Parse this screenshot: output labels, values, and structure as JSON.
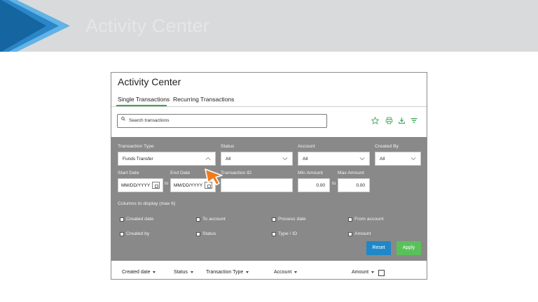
{
  "banner": {
    "title": "Activity Center",
    "colors": {
      "dark": "#1565a0",
      "mid": "#2a86c7",
      "light": "#62b3e6"
    }
  },
  "panel": {
    "title": "Activity Center",
    "tabs": [
      {
        "label": "Single Transactions",
        "active": true
      },
      {
        "label": "Recurring Transactions",
        "active": false
      }
    ],
    "search": {
      "icon": "search-icon",
      "placeholder": "Search transactions"
    },
    "toolbar_icons": [
      "star-icon",
      "print-icon",
      "download-icon",
      "filter-icon"
    ],
    "accent": "#3aa655"
  },
  "filters": {
    "transaction_type": {
      "label": "Transaction Type",
      "value": "Funds Transfer"
    },
    "status": {
      "label": "Status",
      "value": "All"
    },
    "account": {
      "label": "Account",
      "value": "All"
    },
    "created_by": {
      "label": "Created By",
      "value": "All"
    },
    "start_date": {
      "label": "Start Date",
      "placeholder": "MM/DD/YYYY"
    },
    "end_date": {
      "label": "End Date",
      "placeholder": "MM/DD/YYYY"
    },
    "transaction_id": {
      "label": "Transaction ID",
      "value": ""
    },
    "min_amount": {
      "label": "Min Amount",
      "value": "0.00"
    },
    "max_amount": {
      "label": "Max Amount",
      "value": "0.00"
    },
    "to_label": "to",
    "columns_label": "Columns to display (max 6)",
    "columns": [
      "Created date",
      "To account",
      "Process date",
      "From account",
      "Created by",
      "Status",
      "Type / ID",
      "Amount"
    ],
    "reset_label": "Reset",
    "apply_label": "Apply"
  },
  "table": {
    "headers": [
      "Created date",
      "Status",
      "Transaction Type",
      "Account",
      "Amount"
    ]
  }
}
